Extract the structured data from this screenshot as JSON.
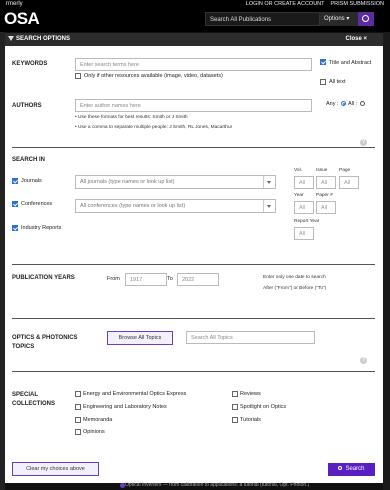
{
  "header": {
    "brand_small": "rmerly",
    "brand": "OSA",
    "links": [
      "LOGIN OR CREATE ACCOUNT",
      "PRISM SUBMISSION"
    ],
    "search_placeholder": "Search All Publications",
    "options_label": "Options ▾"
  },
  "panel": {
    "title": "SEARCH OPTIONS",
    "close_label": "Close ×"
  },
  "keywords": {
    "label": "KEYWORDS",
    "placeholder": "Enter search terms here",
    "only_if_label": "Only if other resources available (image, video, datasets)",
    "title_abstract_label": "Title and Abstract",
    "all_text_label": "All text"
  },
  "authors": {
    "label": "AUTHORS",
    "placeholder": "Enter author names here",
    "any_label": "Any :",
    "all_label": "All :",
    "hints": [
      "Use these formats for best results: Smith or J Smith",
      "Use a comma to separate multiple people: J Smith, RL Jones, Macarthur"
    ]
  },
  "search_in": {
    "label": "SEARCH IN",
    "journals_label": "Journals",
    "journals_select": "All journals (type names or look up list)",
    "conferences_label": "Conferences",
    "conferences_select": "All conferences (type names or look up list)",
    "industry_label": "Industry Reports",
    "vol_label": "Vol.",
    "issue_label": "Issue",
    "page_label": "Page",
    "year_label": "Year",
    "paper_label": "Paper #",
    "report_year_label": "Report Year",
    "all": "All"
  },
  "pub_years": {
    "label": "PUBLICATION YEARS",
    "from_label": "From",
    "from_value": "1917",
    "to_label": "To",
    "to_value": "2022",
    "note_line1": "Enter only one date to search",
    "note_line2": "After (\"From\") or Before (\"To\")"
  },
  "topics": {
    "label_line1": "OPTICS & PHOTONICS",
    "label_line2": "TOPICS",
    "browse_label": "Browse All Topics",
    "search_placeholder": "Search All Topics"
  },
  "collections": {
    "label_line1": "SPECIAL",
    "label_line2": "COLLECTIONS",
    "items": [
      "Energy and Environmental Optics Express",
      "Engineering and Laboratory Notes",
      "Memoranda",
      "Opinions",
      "Reviews",
      "Spotlight on Optics",
      "Tutorials"
    ]
  },
  "footer": {
    "clear_label": "Clear my choices above",
    "search_label": "Search"
  },
  "background": {
    "bottom_text": "Optical Inverters — from calibration to applications: a tutorial (tutorial, Opt. Photon.)"
  }
}
